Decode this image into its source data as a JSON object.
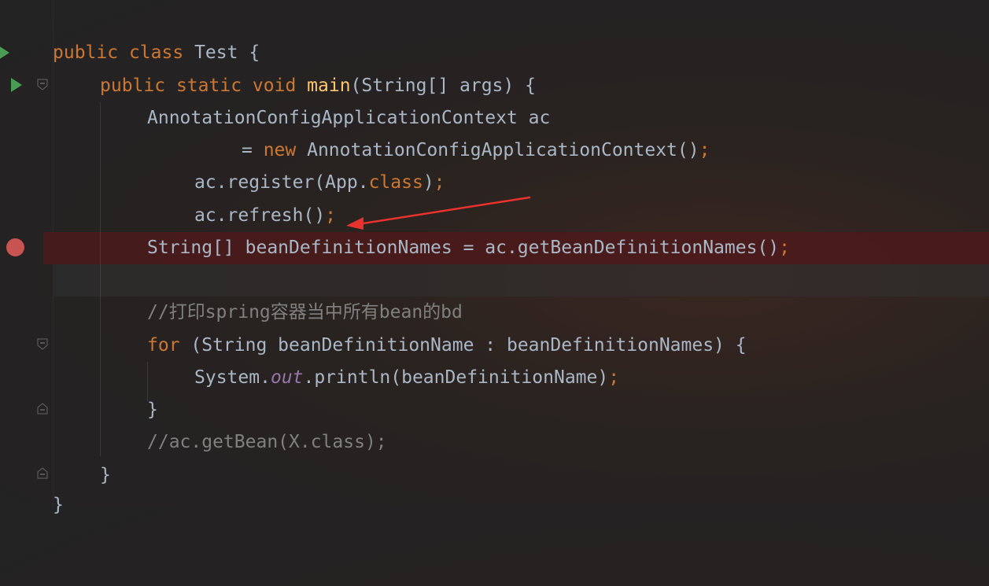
{
  "editor": {
    "lines": {
      "l1": {
        "kw1": "public",
        "kw2": "class",
        "name": "Test",
        "brace": "{"
      },
      "l2": {
        "kw1": "public",
        "kw2": "static",
        "kw3": "void",
        "fn": "main",
        "params": "(String[] args) {"
      },
      "l3": {
        "text": "AnnotationConfigApplicationContext ac"
      },
      "l4": {
        "eq": "= ",
        "kw": "new",
        "rest": " AnnotationConfigApplicationContext()",
        "semi": ";"
      },
      "l5": {
        "pre": "ac.register(App.",
        "kw": "class",
        "post": ")",
        "semi": ";"
      },
      "l6": {
        "text": "ac.refresh()",
        "semi": ";"
      },
      "l7": {
        "text": "String[] beanDefinitionNames = ac.getBeanDefinitionNames()",
        "semi": ";"
      },
      "l9": {
        "comment": "//打印spring容器当中所有bean的bd"
      },
      "l10": {
        "kw": "for",
        "rest": " (String beanDefinitionName : beanDefinitionNames) {"
      },
      "l11": {
        "pre": "System.",
        "field": "out",
        "post": ".println(beanDefinitionName)",
        "semi": ";"
      },
      "l12": {
        "text": "}"
      },
      "l13": {
        "comment": "//ac.getBean(X.class);"
      },
      "l14": {
        "text": "}"
      },
      "l15": {
        "text": "}"
      }
    }
  },
  "colors": {
    "keyword": "#cc7832",
    "method_declaration": "#ffc66d",
    "comment": "#808080",
    "static_field": "#9876aa",
    "default_text": "#a9b7c6",
    "breakpoint": "#c75450",
    "run_icon": "#499c54",
    "annotation_arrow": "#e8322d"
  },
  "icons": {
    "run": "run-triangle-icon",
    "breakpoint": "breakpoint-icon",
    "fold": "fold-marker-icon",
    "arrow": "red-annotation-arrow"
  }
}
